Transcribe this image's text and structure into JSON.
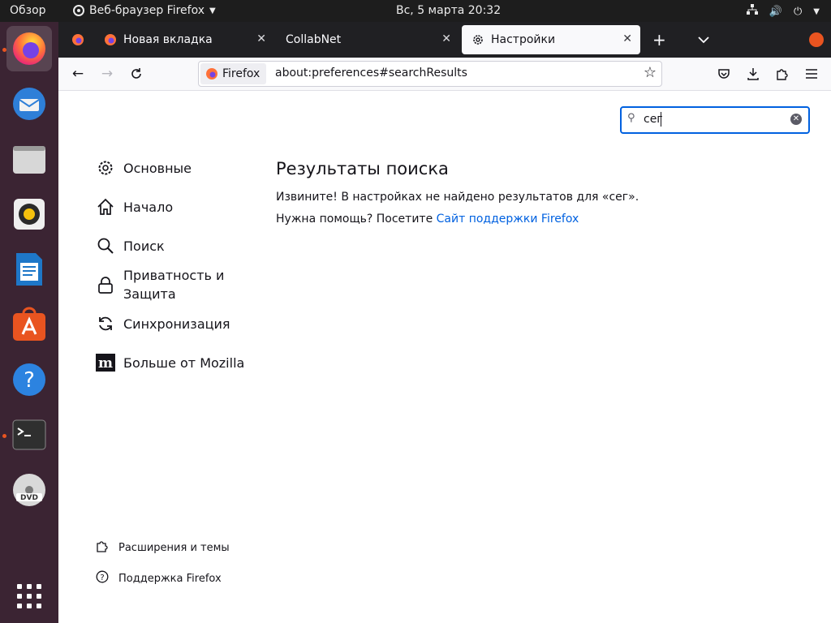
{
  "topbar": {
    "activities": "Обзор",
    "app_menu": "Веб-браузер Firefox",
    "clock": "Вс, 5 марта  20:32"
  },
  "dock": {
    "items": [
      "firefox-icon",
      "thunderbird-icon",
      "files-icon",
      "rhythmbox-icon",
      "libreoffice-writer-icon",
      "ubuntu-software-icon",
      "help-icon",
      "terminal-icon",
      "dvd-icon",
      "show-apps-icon"
    ]
  },
  "tabs": [
    {
      "label": "Новая вкладка"
    },
    {
      "label": "CollabNet"
    },
    {
      "label": "Настройки"
    }
  ],
  "urlbar": {
    "identity": "Firefox",
    "url": "about:preferences#searchResults"
  },
  "search": {
    "value": "сег"
  },
  "categories": [
    {
      "label": "Основные"
    },
    {
      "label": "Начало"
    },
    {
      "label": "Поиск"
    },
    {
      "label": "Приватность и Защита"
    },
    {
      "label": "Синхронизация"
    },
    {
      "label": "Больше от Mozilla"
    }
  ],
  "footer": {
    "addons": "Расширения и темы",
    "support": "Поддержка Firefox"
  },
  "results": {
    "title": "Результаты поиска",
    "sorry": "Извините! В настройках не найдено результатов для «сег».",
    "help_prefix": "Нужна помощь? Посетите ",
    "help_link": "Сайт поддержки Firefox"
  },
  "colors": {
    "accent": "#0061e0",
    "dock_bg": "#3b2433",
    "ubuntu_orange": "#e95420"
  }
}
